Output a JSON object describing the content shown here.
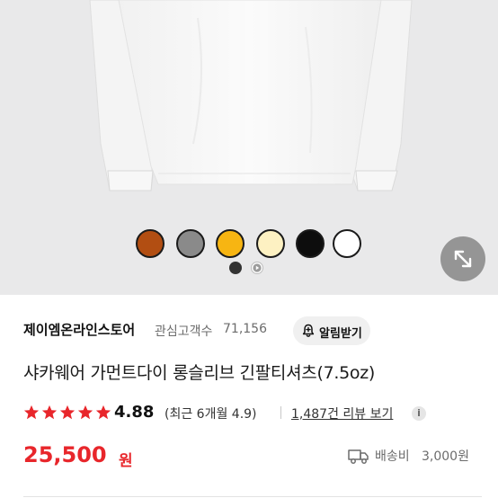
{
  "product_image": {
    "swatches": [
      {
        "name": "brown",
        "color": "#b24e12"
      },
      {
        "name": "gray",
        "color": "#8a8a8a"
      },
      {
        "name": "yellow",
        "color": "#f7b512"
      },
      {
        "name": "cream",
        "color": "#fdf1c2"
      },
      {
        "name": "black",
        "color": "#0d0d0d"
      },
      {
        "name": "white",
        "color": "#ffffff"
      }
    ],
    "pager": {
      "active": 1,
      "total": 2
    }
  },
  "store": {
    "name": "제이엠온라인스토어",
    "favorites_label": "관심고객수",
    "favorites_count": "71,156",
    "notify_button": "알림받기"
  },
  "product": {
    "title": "샤카웨어 가먼트다이 롱슬리브 긴팔티셔츠(7.5oz)",
    "rating": "4.88",
    "rating_stars": 5,
    "recent_rating": "(최근 6개월 4.9)",
    "reviews_link": "1,487건 리뷰 보기",
    "info_icon": "i",
    "price": "25,500",
    "price_unit": "원",
    "shipping_label": "배송비",
    "shipping_cost": "3,000원"
  },
  "colors": {
    "price": "#e8262b",
    "star": "#e8262b"
  }
}
